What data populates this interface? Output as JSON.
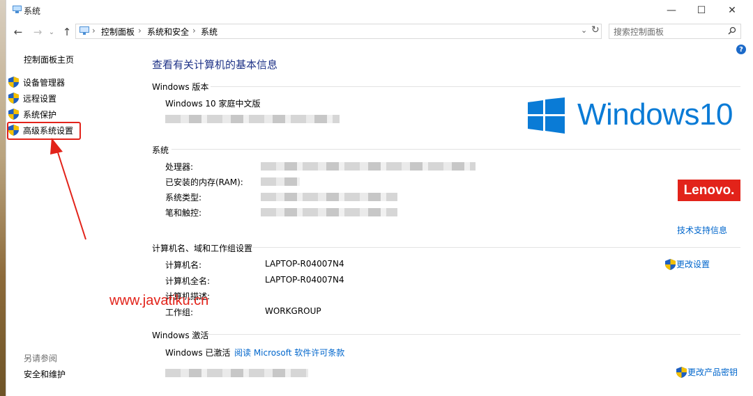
{
  "window": {
    "title": "系统"
  },
  "nav": {
    "breadcrumbs": [
      "控制面板",
      "系统和安全",
      "系统"
    ],
    "search_placeholder": "搜索控制面板"
  },
  "left_pane": {
    "home": "控制面板主页",
    "items": [
      {
        "label": "设备管理器"
      },
      {
        "label": "远程设置"
      },
      {
        "label": "系统保护"
      },
      {
        "label": "高级系统设置"
      }
    ],
    "see_also": "另请参阅",
    "bottom_link": "安全和维护"
  },
  "main": {
    "heading": "查看有关计算机的基本信息",
    "windows_edition": {
      "section": "Windows 版本",
      "edition": "Windows 10 家庭中文版",
      "logo_text": "Windows10"
    },
    "system": {
      "section": "系统",
      "rows": [
        {
          "label": "处理器:"
        },
        {
          "label": "已安装的内存(RAM):"
        },
        {
          "label": "系统类型:"
        },
        {
          "label": "笔和触控:"
        }
      ],
      "oem_logo": "Lenovo.",
      "support_link": "技术支持信息"
    },
    "computer_name": {
      "section": "计算机名、域和工作组设置",
      "rows": [
        {
          "label": "计算机名:",
          "value": "LAPTOP-R04007N4"
        },
        {
          "label": "计算机全名:",
          "value": "LAPTOP-R04007N4"
        },
        {
          "label": "计算机描述:",
          "value": ""
        },
        {
          "label": "工作组:",
          "value": "WORKGROUP"
        }
      ],
      "change_link": "更改设置"
    },
    "activation": {
      "section": "Windows 激活",
      "status": "Windows 已激活",
      "license_link": "阅读 Microsoft 软件许可条款",
      "change_key_link": "更改产品密钥"
    }
  },
  "watermark": "www.javatiku.cn",
  "colors": {
    "heading": "#1e3287",
    "link": "#0066cc",
    "highlight": "#e2231a",
    "win_blue": "#0a7bd6"
  }
}
